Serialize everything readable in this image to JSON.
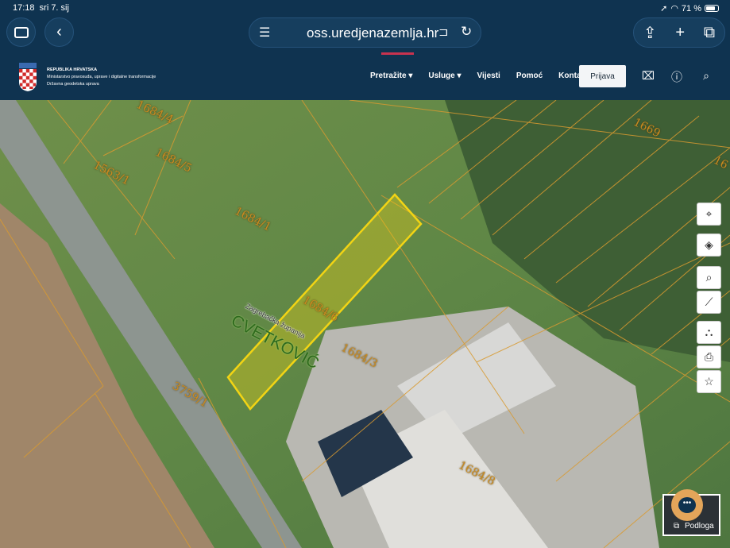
{
  "status": {
    "time": "17:18",
    "date": "sri 7. sij",
    "battery": "71 %",
    "battery_level": 71
  },
  "browser": {
    "url": "oss.uredjenazemlja.hr"
  },
  "header": {
    "org_line1": "REPUBLIKA HRVATSKA",
    "org_line2": "Ministarstvo pravosuđa, uprave i digitalne transformacije",
    "org_line3": "Državna geodetska uprava",
    "nav": [
      "Pretražite",
      "Usluge",
      "Vijesti",
      "Pomoć",
      "Kontakt"
    ],
    "login": "Prijava"
  },
  "map": {
    "parcels": [
      "1684/4",
      "1684/5",
      "1563/1",
      "1684/1",
      "1684/6",
      "1684/3",
      "3759/1",
      "1684/8",
      "1669",
      "16"
    ],
    "county": "Zagrebačka županija",
    "place": "CVETKOVIĆ",
    "highlight_color": "#f2d414",
    "basemap_label": "Podloga"
  }
}
